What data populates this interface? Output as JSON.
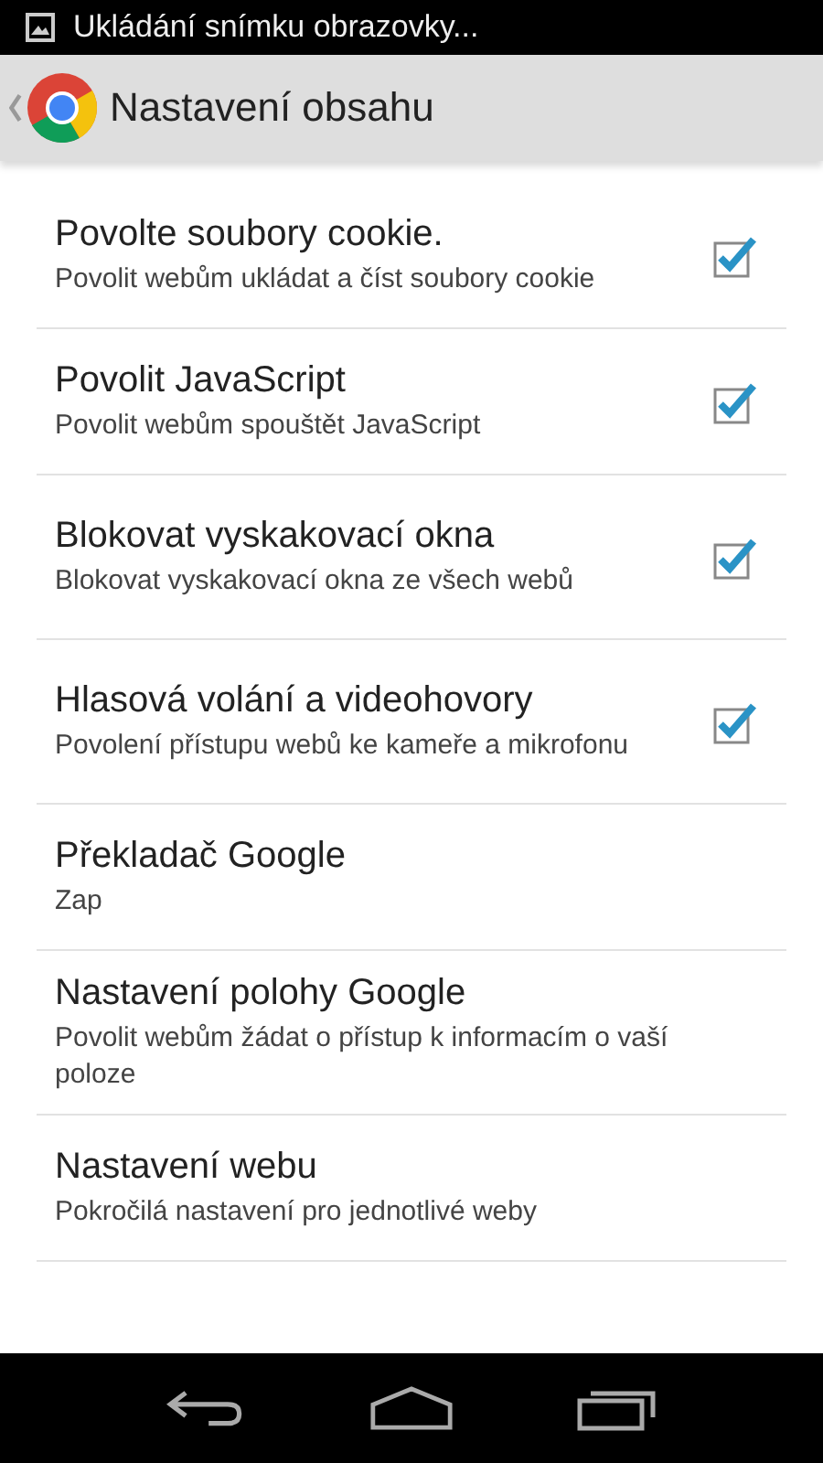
{
  "status_bar": {
    "notification": "Ukládání snímku obrazovky..."
  },
  "action_bar": {
    "title": "Nastavení obsahu"
  },
  "items": [
    {
      "kind": "checkbox",
      "title": "Povolte soubory cookie.",
      "summary": "Povolit webům ukládat a číst soubory cookie",
      "checked": true
    },
    {
      "kind": "checkbox",
      "title": "Povolit JavaScript",
      "summary": "Povolit webům spouštět JavaScript",
      "checked": true
    },
    {
      "kind": "checkbox",
      "title": "Blokovat vyskakovací okna",
      "summary": "Blokovat vyskakovací okna ze všech webů",
      "checked": true
    },
    {
      "kind": "checkbox",
      "title": "Hlasová volání a videohovory",
      "summary": "Povolení přístupu webů ke kameře a mikrofonu",
      "checked": true
    },
    {
      "kind": "plain",
      "title": "Překladač Google",
      "summary": "Zap"
    },
    {
      "kind": "plain",
      "title": "Nastavení polohy Google",
      "summary": "Povolit webům žádat o přístup k informacím o vaší poloze"
    },
    {
      "kind": "plain",
      "title": "Nastavení webu",
      "summary": "Pokročilá nastavení pro jednotlivé weby"
    }
  ]
}
